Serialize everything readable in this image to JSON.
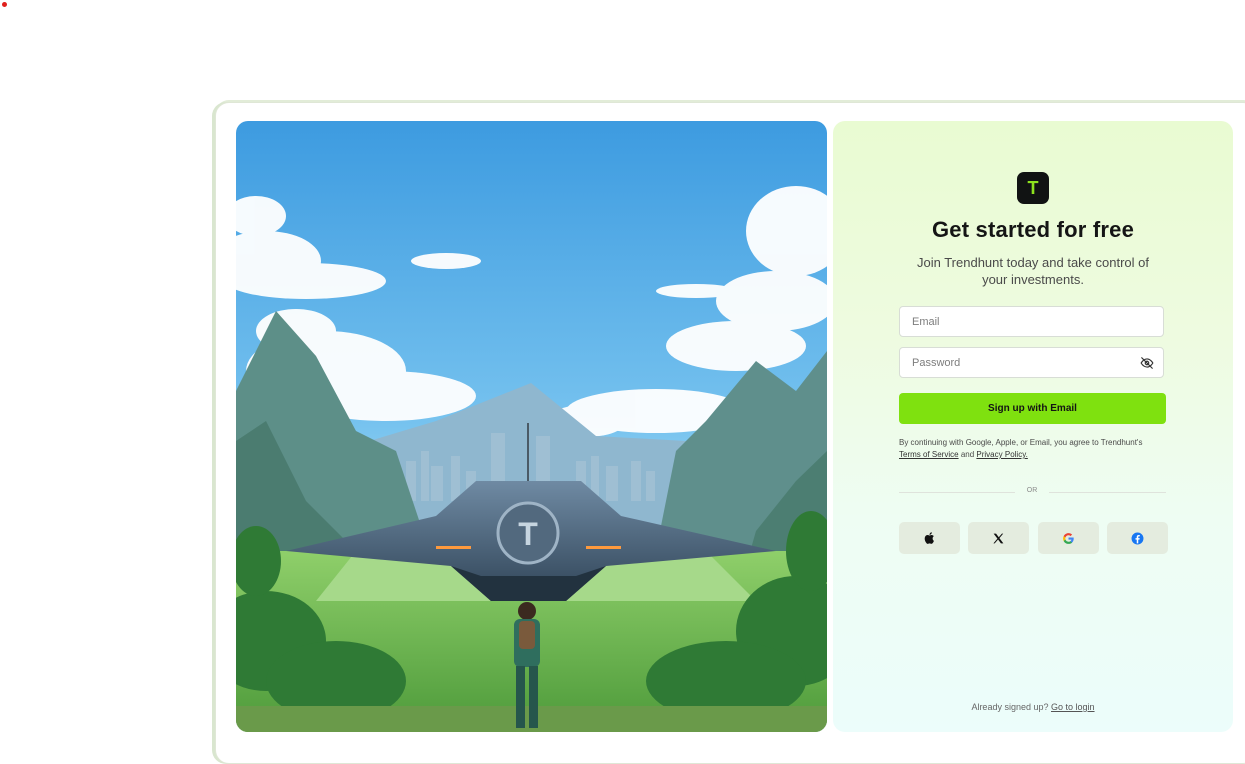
{
  "brand": {
    "logo_letter": "T"
  },
  "signup": {
    "title": "Get started for free",
    "subtitle": "Join Trendhunt today and take control of your investments.",
    "email_placeholder": "Email",
    "password_placeholder": "Password",
    "submit_label": "Sign up with Email",
    "legal_prefix": "By continuing with Google, Apple, or Email, you agree to Trendhunt's",
    "terms_link": "Terms of Service",
    "legal_and": "and",
    "privacy_link": "Privacy Policy.",
    "or_label": "OR"
  },
  "social": [
    {
      "icon": "apple-icon"
    },
    {
      "icon": "x-icon"
    },
    {
      "icon": "google-icon"
    },
    {
      "icon": "facebook-icon"
    }
  ],
  "footer": {
    "prompt": "Already signed up?",
    "login_link": "Go to login"
  },
  "colors": {
    "accent": "#7fe10f",
    "logo_bg": "#111313",
    "logo_letter": "#8de21e",
    "panel_top": "#e9fbd2",
    "panel_bottom": "#ecfdfb"
  }
}
